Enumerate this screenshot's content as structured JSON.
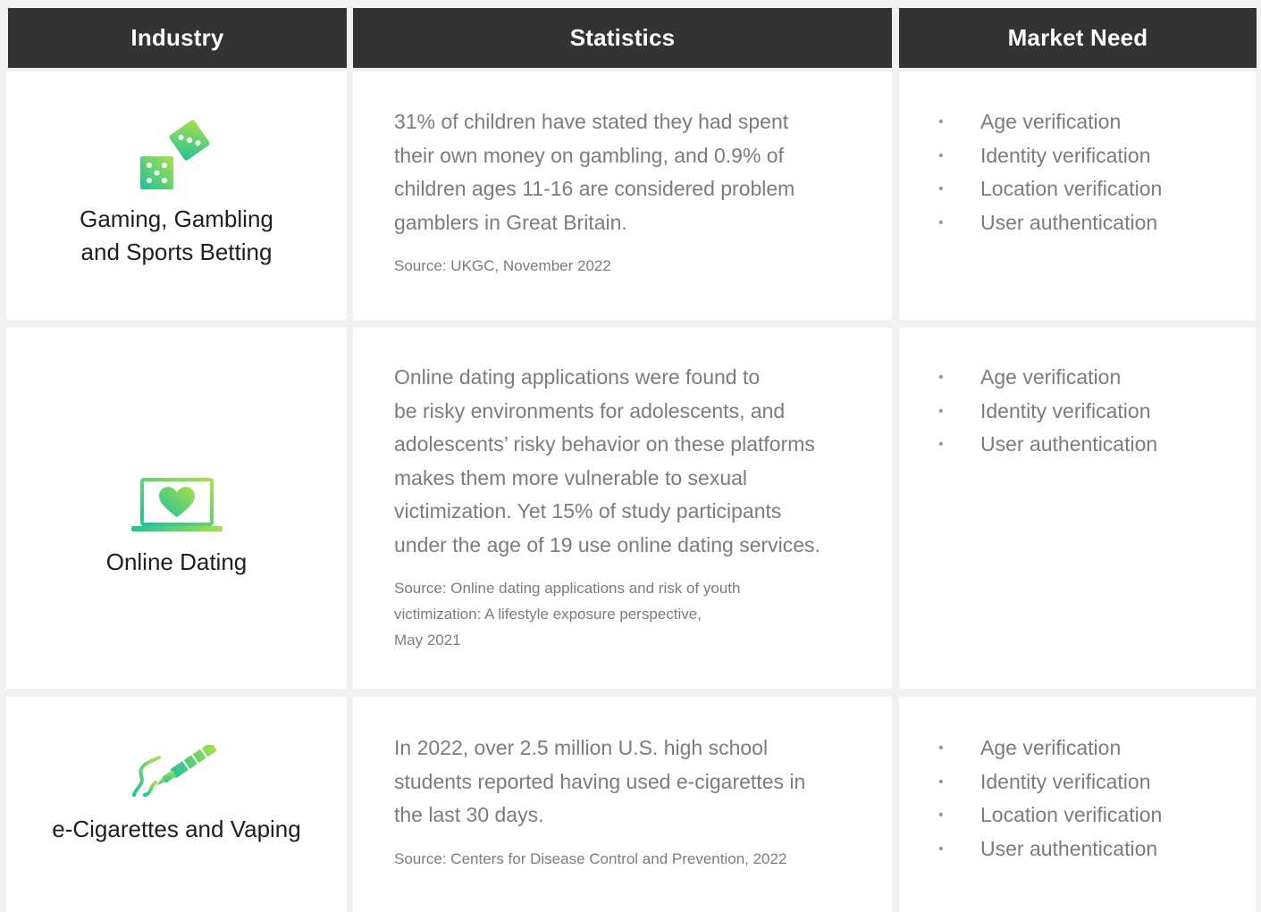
{
  "headers": {
    "industry": "Industry",
    "statistics": "Statistics",
    "market_need": "Market Need"
  },
  "rows": [
    {
      "icon": "dice-icon",
      "industry_line1": "Gaming, Gambling",
      "industry_line2": "and Sports Betting",
      "stat_lines": [
        "31% of children have stated they had spent",
        "their own money on gambling, and 0.9% of",
        "children ages 11-16 are considered problem",
        "gamblers in Great Britain."
      ],
      "source_lines": [
        "Source: UKGC, November 2022"
      ],
      "needs": [
        "Age verification",
        "Identity verification",
        "Location verification",
        "User authentication"
      ]
    },
    {
      "icon": "laptop-heart-icon",
      "industry_line1": "Online Dating",
      "industry_line2": "",
      "stat_lines": [
        "Online dating applications were found to",
        "be risky environments for adolescents, and",
        "adolescents’ risky behavior on these platforms",
        "makes them more vulnerable to sexual",
        "victimization. Yet 15% of study participants",
        "under the age of 19 use online dating services."
      ],
      "source_lines": [
        "Source: Online dating applications and risk of youth",
        "victimization: A lifestyle exposure perspective,",
        "May 2021"
      ],
      "needs": [
        "Age verification",
        "Identity verification",
        "User authentication"
      ]
    },
    {
      "icon": "vape-pen-icon",
      "industry_line1": "e-Cigarettes and Vaping",
      "industry_line2": "",
      "stat_lines": [
        "In 2022, over 2.5 million U.S. high school",
        "students reported having used e-cigarettes in",
        "the last 30 days."
      ],
      "source_lines": [
        "Source: Centers for Disease Control and Prevention, 2022"
      ],
      "needs": [
        "Age verification",
        "Identity verification",
        "Location verification",
        "User authentication"
      ]
    }
  ],
  "bullet": "•",
  "colors": {
    "header_bg": "#333333",
    "header_text": "#ffffff",
    "body_text": "#7c7c7c",
    "industry_text": "#1e1e1e",
    "gradient_start": "#20c997",
    "gradient_end": "#a5e04c"
  }
}
